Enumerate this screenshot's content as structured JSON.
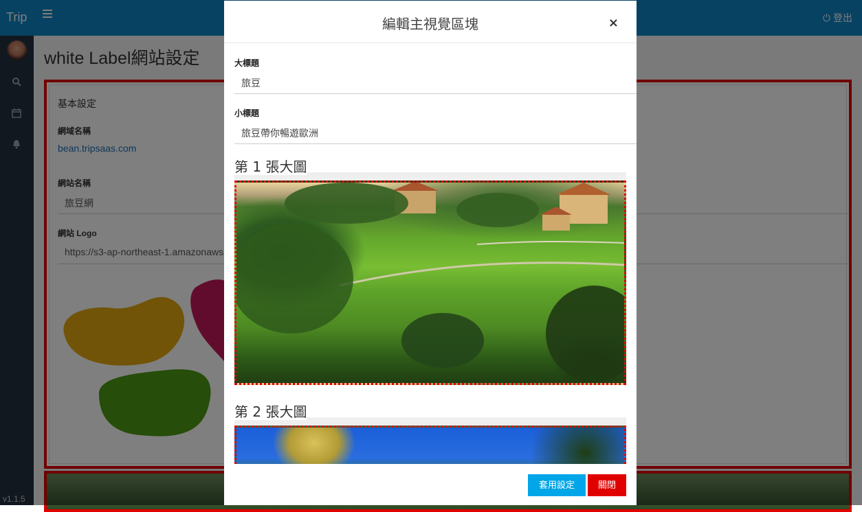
{
  "app": {
    "brand": "Trip",
    "logout_label": "登出",
    "version": "v1.1.5"
  },
  "sidebar": {
    "icons": [
      "search-icon",
      "calendar-icon",
      "bell-icon"
    ]
  },
  "page": {
    "title": "white Label網站設定",
    "section_title": "基本設定",
    "domain_label": "網域名稱",
    "domain_value": "bean.tripsaas.com",
    "site_name_label": "網站名稱",
    "site_name_value": "旅豆網",
    "logo_label": "網站 Logo",
    "logo_url_value": "https://s3-ap-northeast-1.amazonaws."
  },
  "modal": {
    "title": "編輯主視覺區塊",
    "close_symbol": "×",
    "heading_label": "大標題",
    "heading_value": "旅豆",
    "subheading_label": "小標題",
    "subheading_value": "旅豆帶你暢遊歐洲",
    "hero_1_title": "第 1 張大圖",
    "hero_2_title": "第 2 張大圖",
    "apply_button": "套用設定",
    "close_button": "關閉"
  },
  "colors": {
    "topbar": "#0e84c4",
    "sidebar": "#243140",
    "highlight_border": "#e00000",
    "apply_button": "#00a6e8",
    "close_button": "#e00000"
  }
}
